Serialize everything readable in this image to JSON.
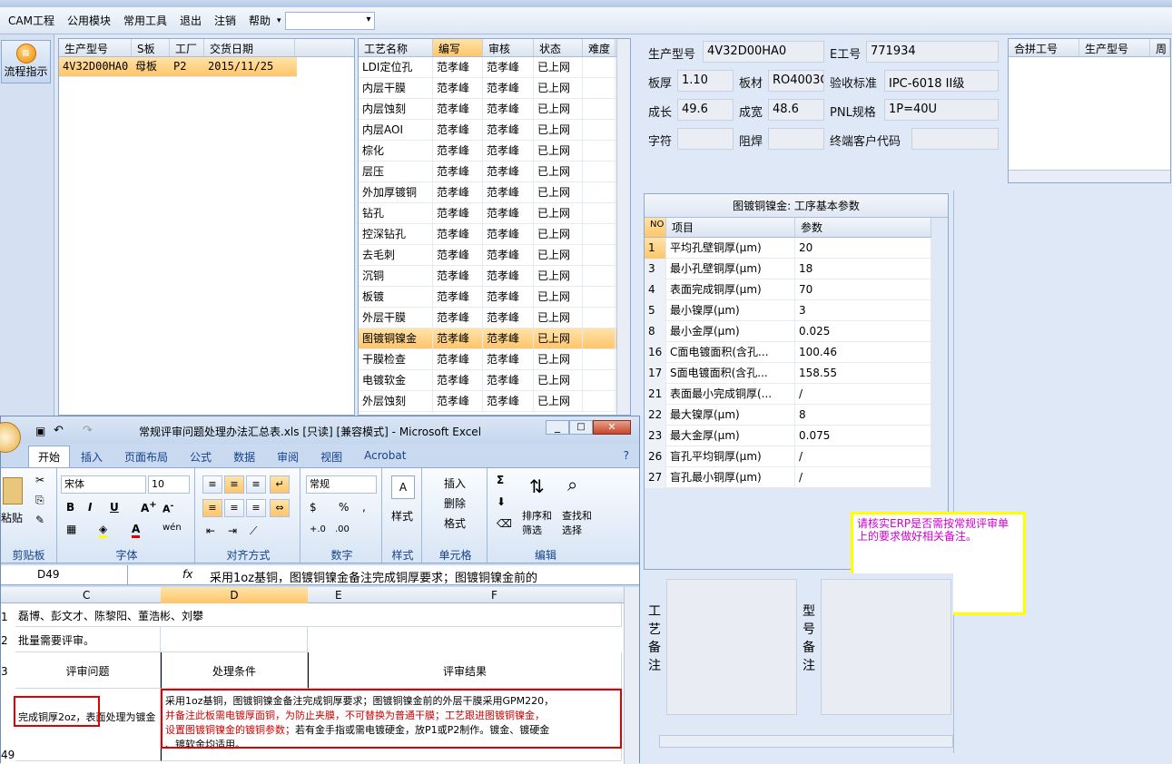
{
  "menubar": {
    "items": [
      "CAM工程",
      "公用模块",
      "常用工具",
      "退出",
      "注销",
      "帮助"
    ]
  },
  "leftbar": {
    "flow_button": "流程指示"
  },
  "orders": {
    "headers": [
      "生产型号",
      "S板",
      "工厂",
      "交货日期"
    ],
    "rows": [
      [
        "4V32D00HA0",
        "母板",
        "P2",
        "2015/11/25"
      ]
    ]
  },
  "process": {
    "headers": [
      "工艺名称",
      "编写",
      "审核",
      "状态",
      "难度"
    ],
    "rows": [
      [
        "LDI定位孔",
        "范孝峰",
        "范孝峰",
        "已上网"
      ],
      [
        "内层干膜",
        "范孝峰",
        "范孝峰",
        "已上网"
      ],
      [
        "内层蚀刻",
        "范孝峰",
        "范孝峰",
        "已上网"
      ],
      [
        "内层AOI",
        "范孝峰",
        "范孝峰",
        "已上网"
      ],
      [
        "棕化",
        "范孝峰",
        "范孝峰",
        "已上网"
      ],
      [
        "层压",
        "范孝峰",
        "范孝峰",
        "已上网"
      ],
      [
        "外加厚镀铜",
        "范孝峰",
        "范孝峰",
        "已上网"
      ],
      [
        "钻孔",
        "范孝峰",
        "范孝峰",
        "已上网"
      ],
      [
        "控深钻孔",
        "范孝峰",
        "范孝峰",
        "已上网"
      ],
      [
        "去毛刺",
        "范孝峰",
        "范孝峰",
        "已上网"
      ],
      [
        "沉铜",
        "范孝峰",
        "范孝峰",
        "已上网"
      ],
      [
        "板镀",
        "范孝峰",
        "范孝峰",
        "已上网"
      ],
      [
        "外层干膜",
        "范孝峰",
        "范孝峰",
        "已上网"
      ],
      [
        "图镀铜镍金",
        "范孝峰",
        "范孝峰",
        "已上网"
      ],
      [
        "干膜检查",
        "范孝峰",
        "范孝峰",
        "已上网"
      ],
      [
        "电镀软金",
        "范孝峰",
        "范孝峰",
        "已上网"
      ],
      [
        "外层蚀刻",
        "范孝峰",
        "范孝峰",
        "已上网"
      ]
    ]
  },
  "info": {
    "model_label": "生产型号",
    "model": "4V32D00HA0",
    "e_label": "E工号",
    "e_no": "771934",
    "thick_label": "板厚",
    "thick": "1.10",
    "mat_label": "板材",
    "mat": "RO4003C",
    "std_label": "验收标准",
    "std": "IPC-6018 II级",
    "len_label": "成长",
    "len": "49.6",
    "wid_label": "成宽",
    "wid": "48.6",
    "pnl_label": "PNL规格",
    "pnl": "1P=40U",
    "char_label": "字符",
    "mask_label": "阻焊",
    "cust_label": "终端客户代码"
  },
  "merge": {
    "headers": [
      "合拼工号",
      "生产型号",
      "周"
    ]
  },
  "params": {
    "title": "图镀铜镍金: 工序基本参数",
    "headers": [
      "NO",
      "项目",
      "参数"
    ],
    "rows": [
      [
        "1",
        "平均孔壁铜厚(μm)",
        "20"
      ],
      [
        "3",
        "最小孔壁铜厚(μm)",
        "18"
      ],
      [
        "4",
        "表面完成铜厚(μm)",
        "70"
      ],
      [
        "5",
        "最小镍厚(μm)",
        "3"
      ],
      [
        "8",
        "最小金厚(μm)",
        "0.025"
      ],
      [
        "16",
        "C面电镀面积(含孔...",
        "100.46"
      ],
      [
        "17",
        "S面电镀面积(含孔...",
        "158.55"
      ],
      [
        "21",
        "表面最小完成铜厚(...",
        "/"
      ],
      [
        "22",
        "最大镍厚(μm)",
        "8"
      ],
      [
        "23",
        "最大金厚(μm)",
        "0.075"
      ],
      [
        "26",
        "盲孔平均铜厚(μm)",
        "/"
      ],
      [
        "27",
        "盲孔最小铜厚(μm)",
        "/"
      ]
    ]
  },
  "note": "请核实ERP是否需按常规评审单上的要求做好相关备注。",
  "remarks": {
    "craft": "工艺备注",
    "model": "型号备注"
  },
  "excel": {
    "title": "常规评审问题处理办法汇总表.xls [只读] [兼容模式] - Microsoft Excel",
    "tabs": [
      "开始",
      "插入",
      "页面布局",
      "公式",
      "数据",
      "审阅",
      "视图",
      "Acrobat"
    ],
    "font": "宋体",
    "size": "10",
    "numfmt": "常规",
    "groups": [
      "剪贴板",
      "字体",
      "对齐方式",
      "数字",
      "样式",
      "单元格",
      "编辑"
    ],
    "cells_btns": [
      "插入",
      "删除",
      "格式"
    ],
    "edit_btns": [
      "排序和筛选",
      "查找和选择"
    ],
    "paste": "粘贴",
    "style": "样式",
    "namebox": "D49",
    "formula": "采用1oz基铜，图镀铜镍金备注完成铜厚要求；图镀铜镍金前的",
    "cols": [
      "C",
      "D",
      "E",
      "F"
    ],
    "rows": [
      "1",
      "2",
      "3",
      "49"
    ],
    "r1": "磊博、彭文才、陈黎阳、董浩彬、刘攀",
    "r2": "批量需要评审。",
    "h_issue": "评审问题",
    "h_cond": "处理条件",
    "h_result": "评审结果",
    "c49": "完成铜厚2oz，表面处理为镀金",
    "d49a": "采用1oz基铜，图镀铜镍金备注完成铜厚要求；图镀铜镍金前的外层干膜采用GPM220，",
    "d49b": "并备注此板需电镀厚面铜，为防止夹膜，不可替换为普通干膜；工艺跟进图镀铜镍金，",
    "d49c": "设置图镀铜镍金的镀铜参数；",
    "d49d": "若有金手指或需电镀硬金，放P1或P2制作。镀金、镀硬金",
    "d49e": "、镀软金均适用。"
  }
}
